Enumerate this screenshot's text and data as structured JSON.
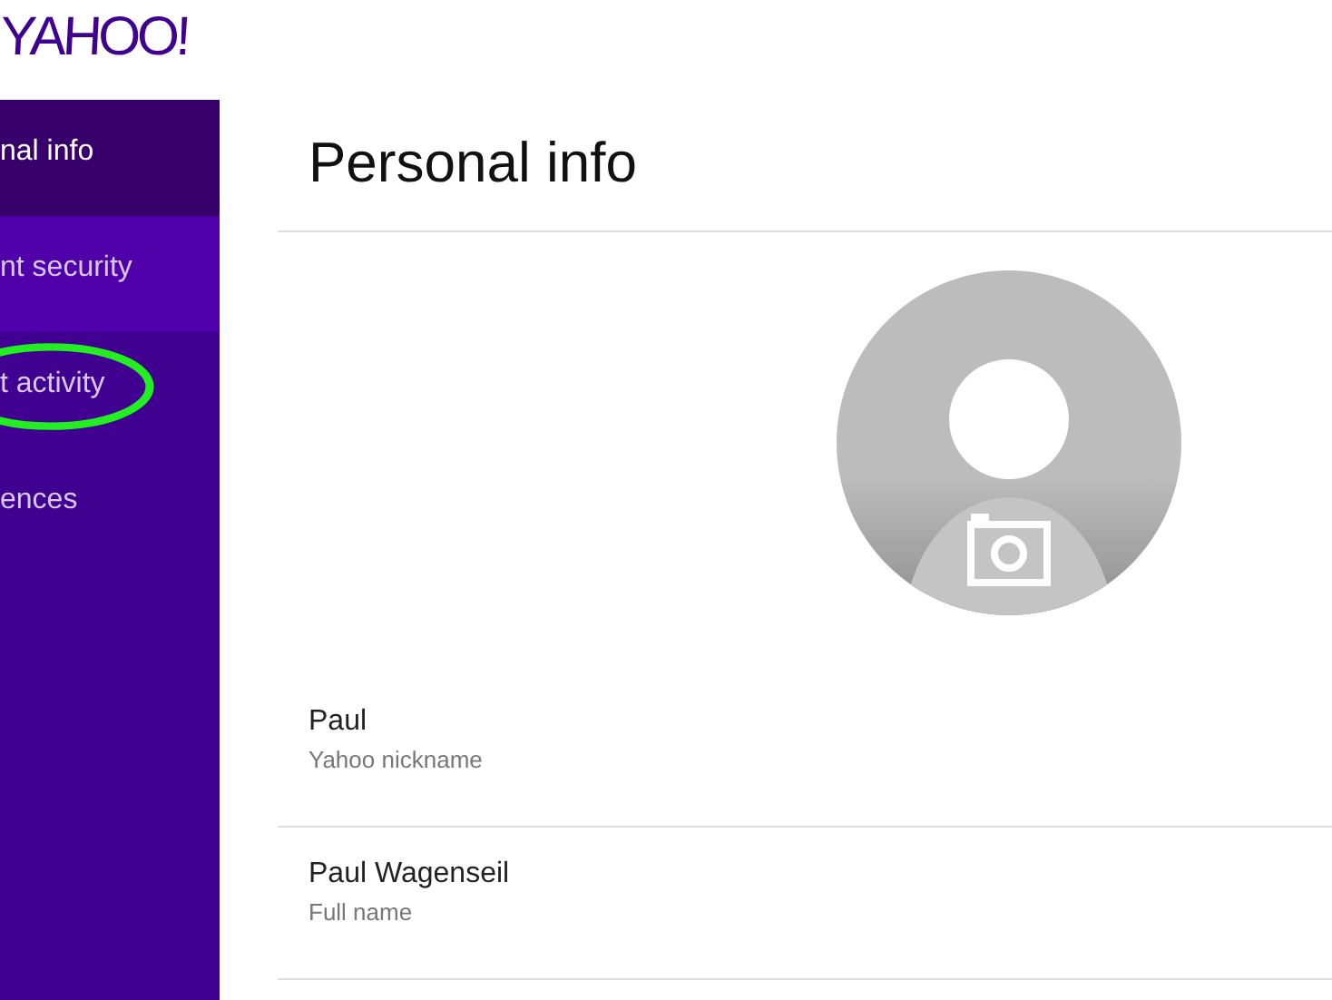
{
  "logo": "YAHOO!",
  "sidebar": {
    "items": [
      {
        "label": "nal info",
        "selected": true,
        "hovered": false,
        "circled": false
      },
      {
        "label": "nt security",
        "selected": false,
        "hovered": true,
        "circled": false
      },
      {
        "label": "t activity",
        "selected": false,
        "hovered": false,
        "circled": true
      },
      {
        "label": "ences",
        "selected": false,
        "hovered": false,
        "circled": false
      }
    ]
  },
  "page": {
    "title": "Personal info",
    "fields": [
      {
        "value": "Paul",
        "label": "Yahoo nickname"
      },
      {
        "value": "Paul Wagenseil",
        "label": "Full name"
      }
    ]
  }
}
